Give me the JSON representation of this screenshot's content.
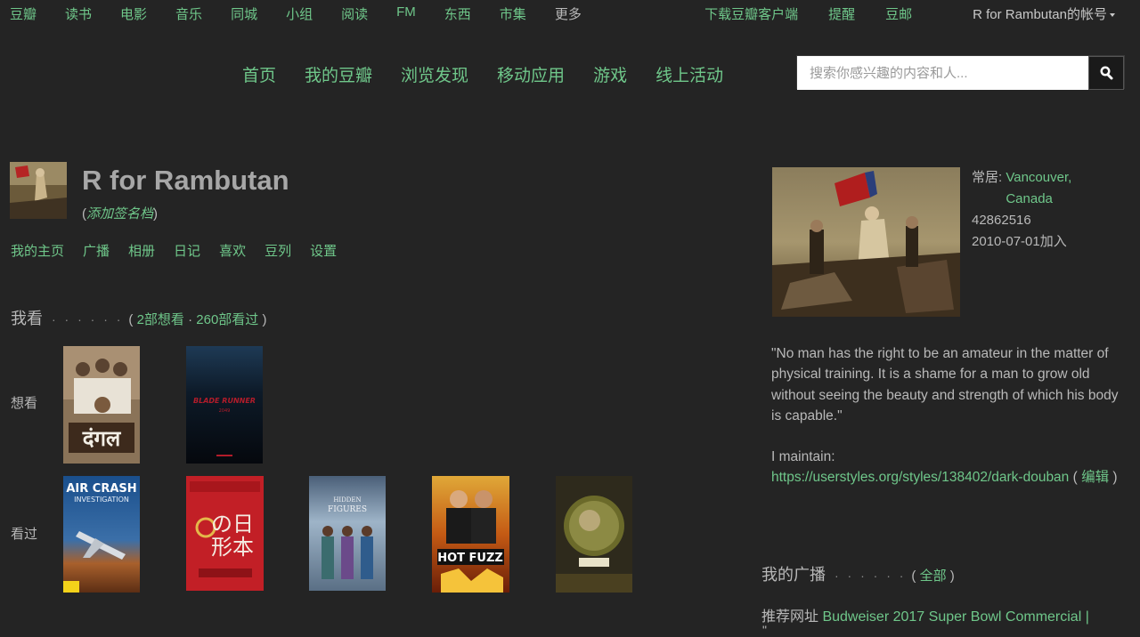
{
  "topbar": {
    "left": [
      "豆瓣",
      "读书",
      "电影",
      "音乐",
      "同城",
      "小组",
      "阅读",
      "FM",
      "东西",
      "市集",
      "更多"
    ],
    "right": [
      "下载豆瓣客户端",
      "提醒",
      "豆邮"
    ],
    "account": "R for Rambutan的帐号"
  },
  "mainnav": [
    "首页",
    "我的豆瓣",
    "浏览发现",
    "移动应用",
    "游戏",
    "线上活动"
  ],
  "search": {
    "placeholder": "搜索你感兴趣的内容和人..."
  },
  "profile": {
    "name": "R for Rambutan",
    "signature_open": "(",
    "signature_link": "添加签名档",
    "signature_close": ")",
    "subnav": [
      "我的主页",
      "广播",
      "相册",
      "日记",
      "喜欢",
      "豆列",
      "设置"
    ]
  },
  "movies": {
    "title": "我看",
    "dots": "· · · · · ·",
    "open": "(",
    "wish_link": "2部想看",
    "sep": "·",
    "seen_link": "260部看过",
    "close": ")",
    "wish_label": "想看",
    "seen_label": "看过",
    "wish_posters": [
      {
        "name": "dangal-poster",
        "text": "दंगल"
      },
      {
        "name": "blade-runner-poster",
        "text": "BLADE RUNNER",
        "sub": "2049"
      }
    ],
    "seen_posters": [
      {
        "name": "air-crash-poster",
        "text": "AIR CRASH",
        "sub": "INVESTIGATION"
      },
      {
        "name": "nihon-no-ichiban-poster",
        "text": "の日",
        "sub": "形本"
      },
      {
        "name": "hidden-figures-poster",
        "text": "HIDDEN",
        "sub": "FIGURES"
      },
      {
        "name": "hot-fuzz-poster",
        "text": "HOT FUZZ"
      },
      {
        "name": "earth-poster",
        "text": ""
      }
    ]
  },
  "sidebar": {
    "resides_label": "常居: ",
    "resides_link": "Vancouver, Canada",
    "uid": "42862516",
    "joined": "2010-07-01加入",
    "quote": "\"No man has the right to be an amateur in the matter of physical training. It is a shame for a man to grow old without seeing the beauty and strength of which his body is capable.\"",
    "maintain_label": "I maintain:",
    "maintain_link": "https://userstyles.org/styles/138402/dark-douban",
    "edit_open": " ( ",
    "edit_link": "编辑",
    "edit_close": " )",
    "broadcast_title": "我的广播",
    "broadcast_dots": "· · · · · ·",
    "broadcast_open": "(",
    "broadcast_all": "全部",
    "broadcast_close": ")",
    "rec_label": "推荐网址 ",
    "rec_link": "Budweiser 2017 Super Bowl Commercial |",
    "rec_more": "\""
  },
  "colors": {
    "link": "#6fc78a",
    "bg": "#242424",
    "text": "#b9b9b9"
  }
}
